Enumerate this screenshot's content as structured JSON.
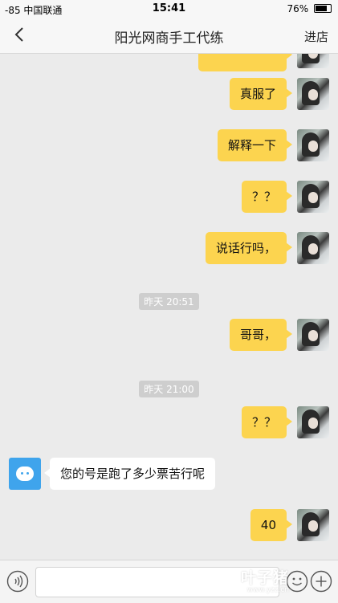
{
  "status_bar": {
    "signal": "-85 中国联通",
    "time": "15:41",
    "battery": "76%"
  },
  "nav": {
    "title": "阳光网商手工代练",
    "right_button": "进店"
  },
  "messages": [
    {
      "from": "me",
      "text": "真服了"
    },
    {
      "from": "me",
      "text": "解释一下"
    },
    {
      "from": "me",
      "text": "？？"
    },
    {
      "from": "me",
      "text": "说话行吗，"
    },
    {
      "from": "me",
      "text": "哥哥，"
    },
    {
      "from": "me",
      "text": "？？"
    },
    {
      "from": "them",
      "text": "您的号是跑了多少票苦行呢"
    },
    {
      "from": "me",
      "text": "40"
    }
  ],
  "timestamps": [
    "昨天 20:51",
    "昨天 21:00"
  ],
  "watermark": {
    "main": "叶子猪",
    "sub": "www.yzz.cn"
  },
  "colors": {
    "my_bubble": "#fcd44f",
    "their_bubble": "#ffffff",
    "background": "#ebebeb"
  }
}
